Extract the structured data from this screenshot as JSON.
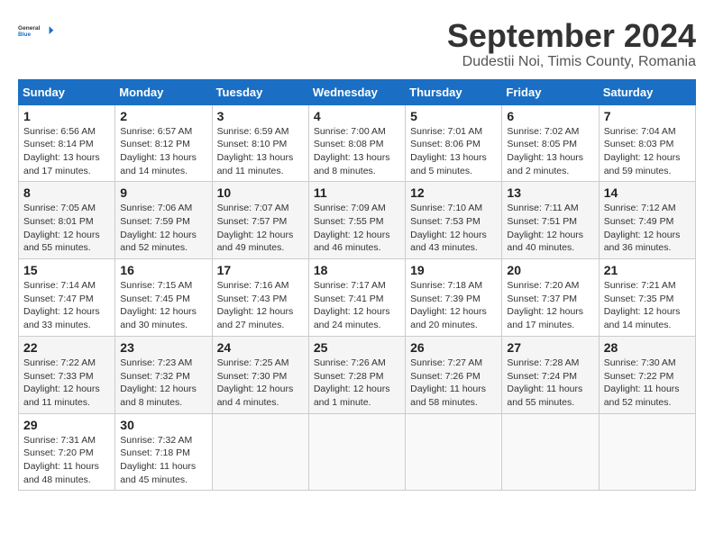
{
  "header": {
    "logo_line1": "General",
    "logo_line2": "Blue",
    "month": "September 2024",
    "location": "Dudestii Noi, Timis County, Romania"
  },
  "weekdays": [
    "Sunday",
    "Monday",
    "Tuesday",
    "Wednesday",
    "Thursday",
    "Friday",
    "Saturday"
  ],
  "weeks": [
    [
      {
        "day": "1",
        "info": "Sunrise: 6:56 AM\nSunset: 8:14 PM\nDaylight: 13 hours\nand 17 minutes."
      },
      {
        "day": "2",
        "info": "Sunrise: 6:57 AM\nSunset: 8:12 PM\nDaylight: 13 hours\nand 14 minutes."
      },
      {
        "day": "3",
        "info": "Sunrise: 6:59 AM\nSunset: 8:10 PM\nDaylight: 13 hours\nand 11 minutes."
      },
      {
        "day": "4",
        "info": "Sunrise: 7:00 AM\nSunset: 8:08 PM\nDaylight: 13 hours\nand 8 minutes."
      },
      {
        "day": "5",
        "info": "Sunrise: 7:01 AM\nSunset: 8:06 PM\nDaylight: 13 hours\nand 5 minutes."
      },
      {
        "day": "6",
        "info": "Sunrise: 7:02 AM\nSunset: 8:05 PM\nDaylight: 13 hours\nand 2 minutes."
      },
      {
        "day": "7",
        "info": "Sunrise: 7:04 AM\nSunset: 8:03 PM\nDaylight: 12 hours\nand 59 minutes."
      }
    ],
    [
      {
        "day": "8",
        "info": "Sunrise: 7:05 AM\nSunset: 8:01 PM\nDaylight: 12 hours\nand 55 minutes."
      },
      {
        "day": "9",
        "info": "Sunrise: 7:06 AM\nSunset: 7:59 PM\nDaylight: 12 hours\nand 52 minutes."
      },
      {
        "day": "10",
        "info": "Sunrise: 7:07 AM\nSunset: 7:57 PM\nDaylight: 12 hours\nand 49 minutes."
      },
      {
        "day": "11",
        "info": "Sunrise: 7:09 AM\nSunset: 7:55 PM\nDaylight: 12 hours\nand 46 minutes."
      },
      {
        "day": "12",
        "info": "Sunrise: 7:10 AM\nSunset: 7:53 PM\nDaylight: 12 hours\nand 43 minutes."
      },
      {
        "day": "13",
        "info": "Sunrise: 7:11 AM\nSunset: 7:51 PM\nDaylight: 12 hours\nand 40 minutes."
      },
      {
        "day": "14",
        "info": "Sunrise: 7:12 AM\nSunset: 7:49 PM\nDaylight: 12 hours\nand 36 minutes."
      }
    ],
    [
      {
        "day": "15",
        "info": "Sunrise: 7:14 AM\nSunset: 7:47 PM\nDaylight: 12 hours\nand 33 minutes."
      },
      {
        "day": "16",
        "info": "Sunrise: 7:15 AM\nSunset: 7:45 PM\nDaylight: 12 hours\nand 30 minutes."
      },
      {
        "day": "17",
        "info": "Sunrise: 7:16 AM\nSunset: 7:43 PM\nDaylight: 12 hours\nand 27 minutes."
      },
      {
        "day": "18",
        "info": "Sunrise: 7:17 AM\nSunset: 7:41 PM\nDaylight: 12 hours\nand 24 minutes."
      },
      {
        "day": "19",
        "info": "Sunrise: 7:18 AM\nSunset: 7:39 PM\nDaylight: 12 hours\nand 20 minutes."
      },
      {
        "day": "20",
        "info": "Sunrise: 7:20 AM\nSunset: 7:37 PM\nDaylight: 12 hours\nand 17 minutes."
      },
      {
        "day": "21",
        "info": "Sunrise: 7:21 AM\nSunset: 7:35 PM\nDaylight: 12 hours\nand 14 minutes."
      }
    ],
    [
      {
        "day": "22",
        "info": "Sunrise: 7:22 AM\nSunset: 7:33 PM\nDaylight: 12 hours\nand 11 minutes."
      },
      {
        "day": "23",
        "info": "Sunrise: 7:23 AM\nSunset: 7:32 PM\nDaylight: 12 hours\nand 8 minutes."
      },
      {
        "day": "24",
        "info": "Sunrise: 7:25 AM\nSunset: 7:30 PM\nDaylight: 12 hours\nand 4 minutes."
      },
      {
        "day": "25",
        "info": "Sunrise: 7:26 AM\nSunset: 7:28 PM\nDaylight: 12 hours\nand 1 minute."
      },
      {
        "day": "26",
        "info": "Sunrise: 7:27 AM\nSunset: 7:26 PM\nDaylight: 11 hours\nand 58 minutes."
      },
      {
        "day": "27",
        "info": "Sunrise: 7:28 AM\nSunset: 7:24 PM\nDaylight: 11 hours\nand 55 minutes."
      },
      {
        "day": "28",
        "info": "Sunrise: 7:30 AM\nSunset: 7:22 PM\nDaylight: 11 hours\nand 52 minutes."
      }
    ],
    [
      {
        "day": "29",
        "info": "Sunrise: 7:31 AM\nSunset: 7:20 PM\nDaylight: 11 hours\nand 48 minutes."
      },
      {
        "day": "30",
        "info": "Sunrise: 7:32 AM\nSunset: 7:18 PM\nDaylight: 11 hours\nand 45 minutes."
      },
      {
        "day": "",
        "info": ""
      },
      {
        "day": "",
        "info": ""
      },
      {
        "day": "",
        "info": ""
      },
      {
        "day": "",
        "info": ""
      },
      {
        "day": "",
        "info": ""
      }
    ]
  ]
}
